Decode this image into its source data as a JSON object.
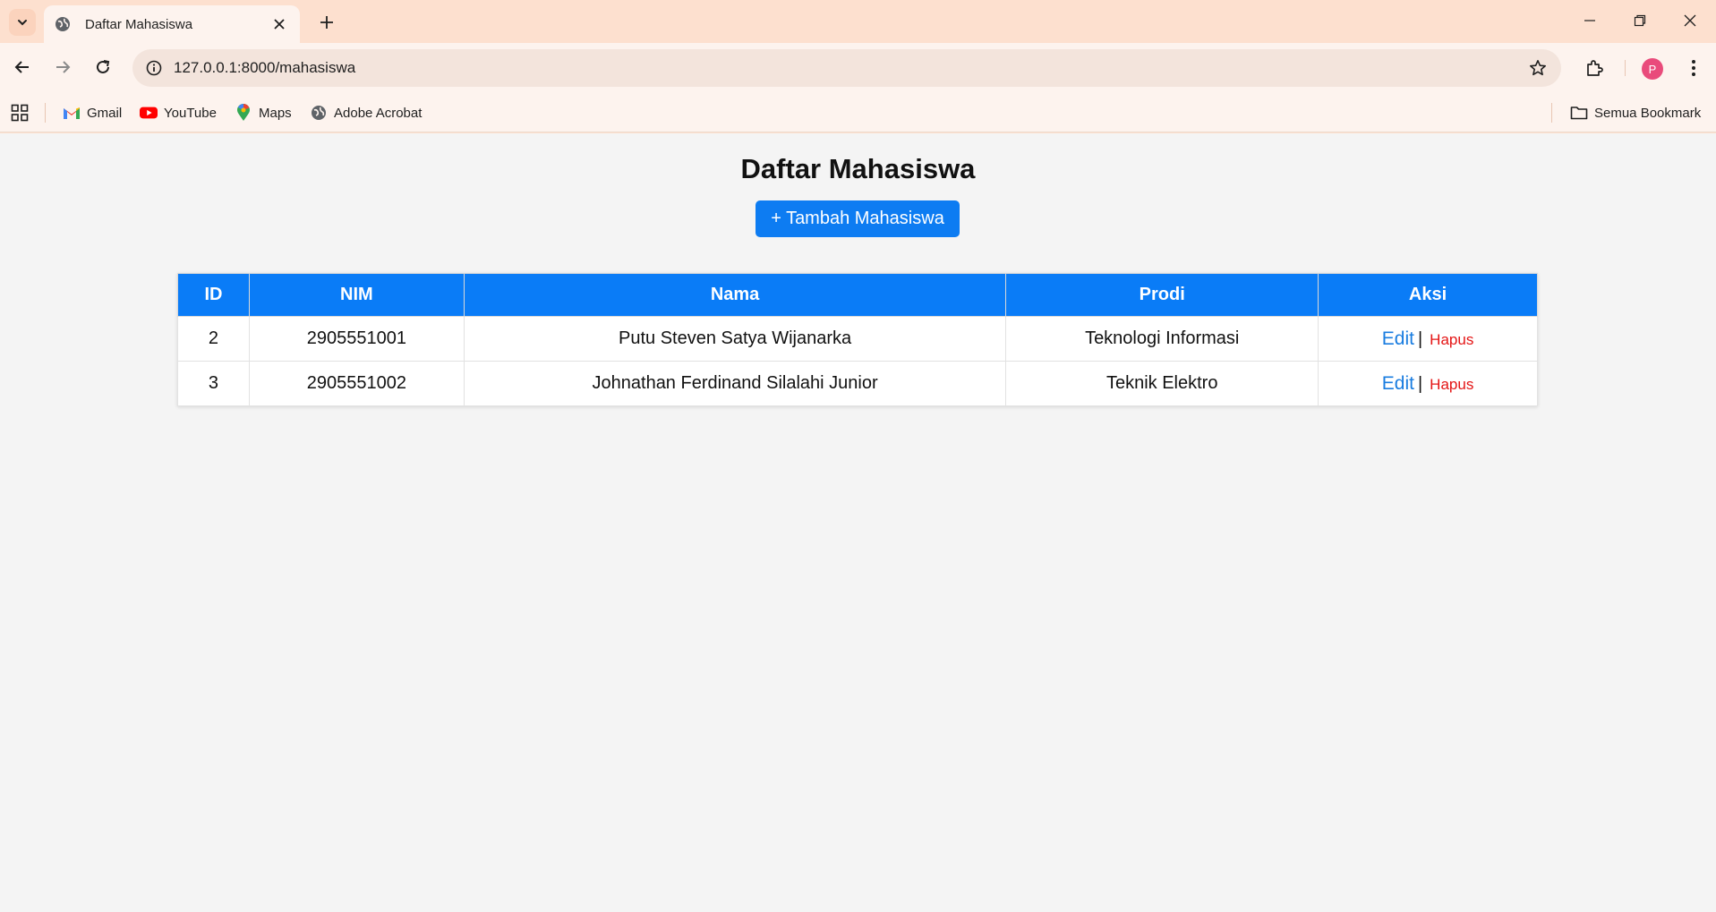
{
  "browser": {
    "tab_title": "Daftar Mahasiswa",
    "url": "127.0.0.1:8000/mahasiswa",
    "profile_initial": "P",
    "bookmarks": [
      {
        "label": "Gmail",
        "icon": "gmail-icon"
      },
      {
        "label": "YouTube",
        "icon": "youtube-icon"
      },
      {
        "label": "Maps",
        "icon": "maps-icon"
      },
      {
        "label": "Adobe Acrobat",
        "icon": "globe-icon"
      }
    ],
    "all_bookmarks_label": "Semua Bookmark"
  },
  "page": {
    "title": "Daftar Mahasiswa",
    "add_button": "+ Tambah Mahasiswa"
  },
  "table": {
    "headers": [
      "ID",
      "NIM",
      "Nama",
      "Prodi",
      "Aksi"
    ],
    "rows": [
      {
        "id": "2",
        "nim": "2905551001",
        "nama": "Putu Steven Satya Wijanarka",
        "prodi": "Teknologi Informasi",
        "edit": "Edit",
        "separator": "|",
        "hapus": "Hapus"
      },
      {
        "id": "3",
        "nim": "2905551002",
        "nama": "Johnathan Ferdinand Silalahi Junior",
        "prodi": "Teknik Elektro",
        "edit": "Edit",
        "separator": "|",
        "hapus": "Hapus"
      }
    ]
  },
  "colors": {
    "chrome_bg": "#fde0cf",
    "toolbar_bg": "#fdf3ee",
    "page_bg": "#f4f4f4",
    "primary": "#0a7cf7",
    "edit_link": "#1a7de0",
    "hapus_link": "#e41414"
  }
}
